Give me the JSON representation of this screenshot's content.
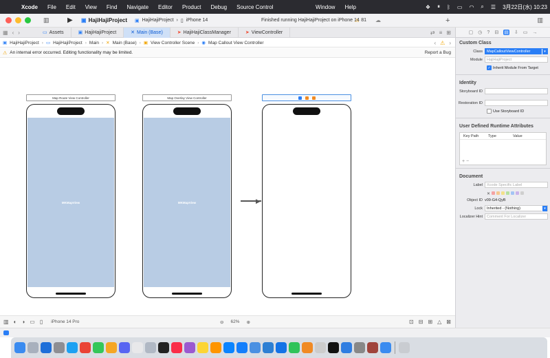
{
  "menubar": {
    "app_name": "Xcode",
    "items": [
      "File",
      "Edit",
      "View",
      "Find",
      "Navigate",
      "Editor",
      "Product",
      "Debug",
      "Source Control"
    ],
    "items_right": [
      "Window",
      "Help"
    ],
    "datetime": "3月22日(水) 10:23"
  },
  "toolbar": {
    "project": "HajiHajiProject",
    "scheme": "HajiHajiProject",
    "device": "iPhone 14",
    "status": "Finished running HajiHajiProject on iPhone 14",
    "warning_count": "81"
  },
  "tabs": [
    {
      "label": "Assets",
      "icon": "folder-icon"
    },
    {
      "label": "HajiHajiProject",
      "icon": "project-icon"
    },
    {
      "label": "Main (Base)",
      "icon": "storyboard-icon",
      "active": true
    },
    {
      "label": "HajiHajiClassManager",
      "icon": "swift-icon"
    },
    {
      "label": "ViewController",
      "icon": "swift-icon"
    }
  ],
  "jumpbar": [
    "HajiHajiProject",
    "HajiHajiProject",
    "Main",
    "Main (Base)",
    "View Controller Scene",
    "Map Callout View Controller"
  ],
  "error": {
    "message": "An internal error occurred. Editing functionality may be limited.",
    "report": "Report a Bug"
  },
  "scenes": [
    {
      "title": "Map Route View Controller",
      "map_label": "MKMapView"
    },
    {
      "title": "Map Overlay View Controller",
      "map_label": "MKMapView"
    }
  ],
  "bottombar": {
    "device": "iPhone 14 Pro",
    "zoom": "62%"
  },
  "inspector": {
    "custom_class": {
      "title": "Custom Class",
      "class_label": "Class",
      "class_value": "MapCalloutViewController",
      "module_label": "Module",
      "module_placeholder": "HajiHajiProject",
      "inherit_label": "Inherit Module From Target"
    },
    "identity": {
      "title": "Identity",
      "storyboard_id_label": "Storyboard ID",
      "restoration_id_label": "Restoration ID",
      "use_storyboard_label": "Use Storyboard ID"
    },
    "runtime": {
      "title": "User Defined Runtime Attributes",
      "col_keypath": "Key Path",
      "col_type": "Type",
      "col_value": "Value"
    },
    "document": {
      "title": "Document",
      "label_label": "Label",
      "label_placeholder": "Xcode Specific Label",
      "object_id_label": "Object ID",
      "object_id_value": "v09-G4-QyB",
      "lock_label": "Lock",
      "lock_value": "Inherited - (Nothing)",
      "hint_label": "Localizer Hint",
      "hint_placeholder": "Comment For Localizer"
    }
  },
  "colors": {
    "accent": "#2a7ef6",
    "map_fill": "#b8cce4",
    "menubar": "#2b2b30"
  }
}
